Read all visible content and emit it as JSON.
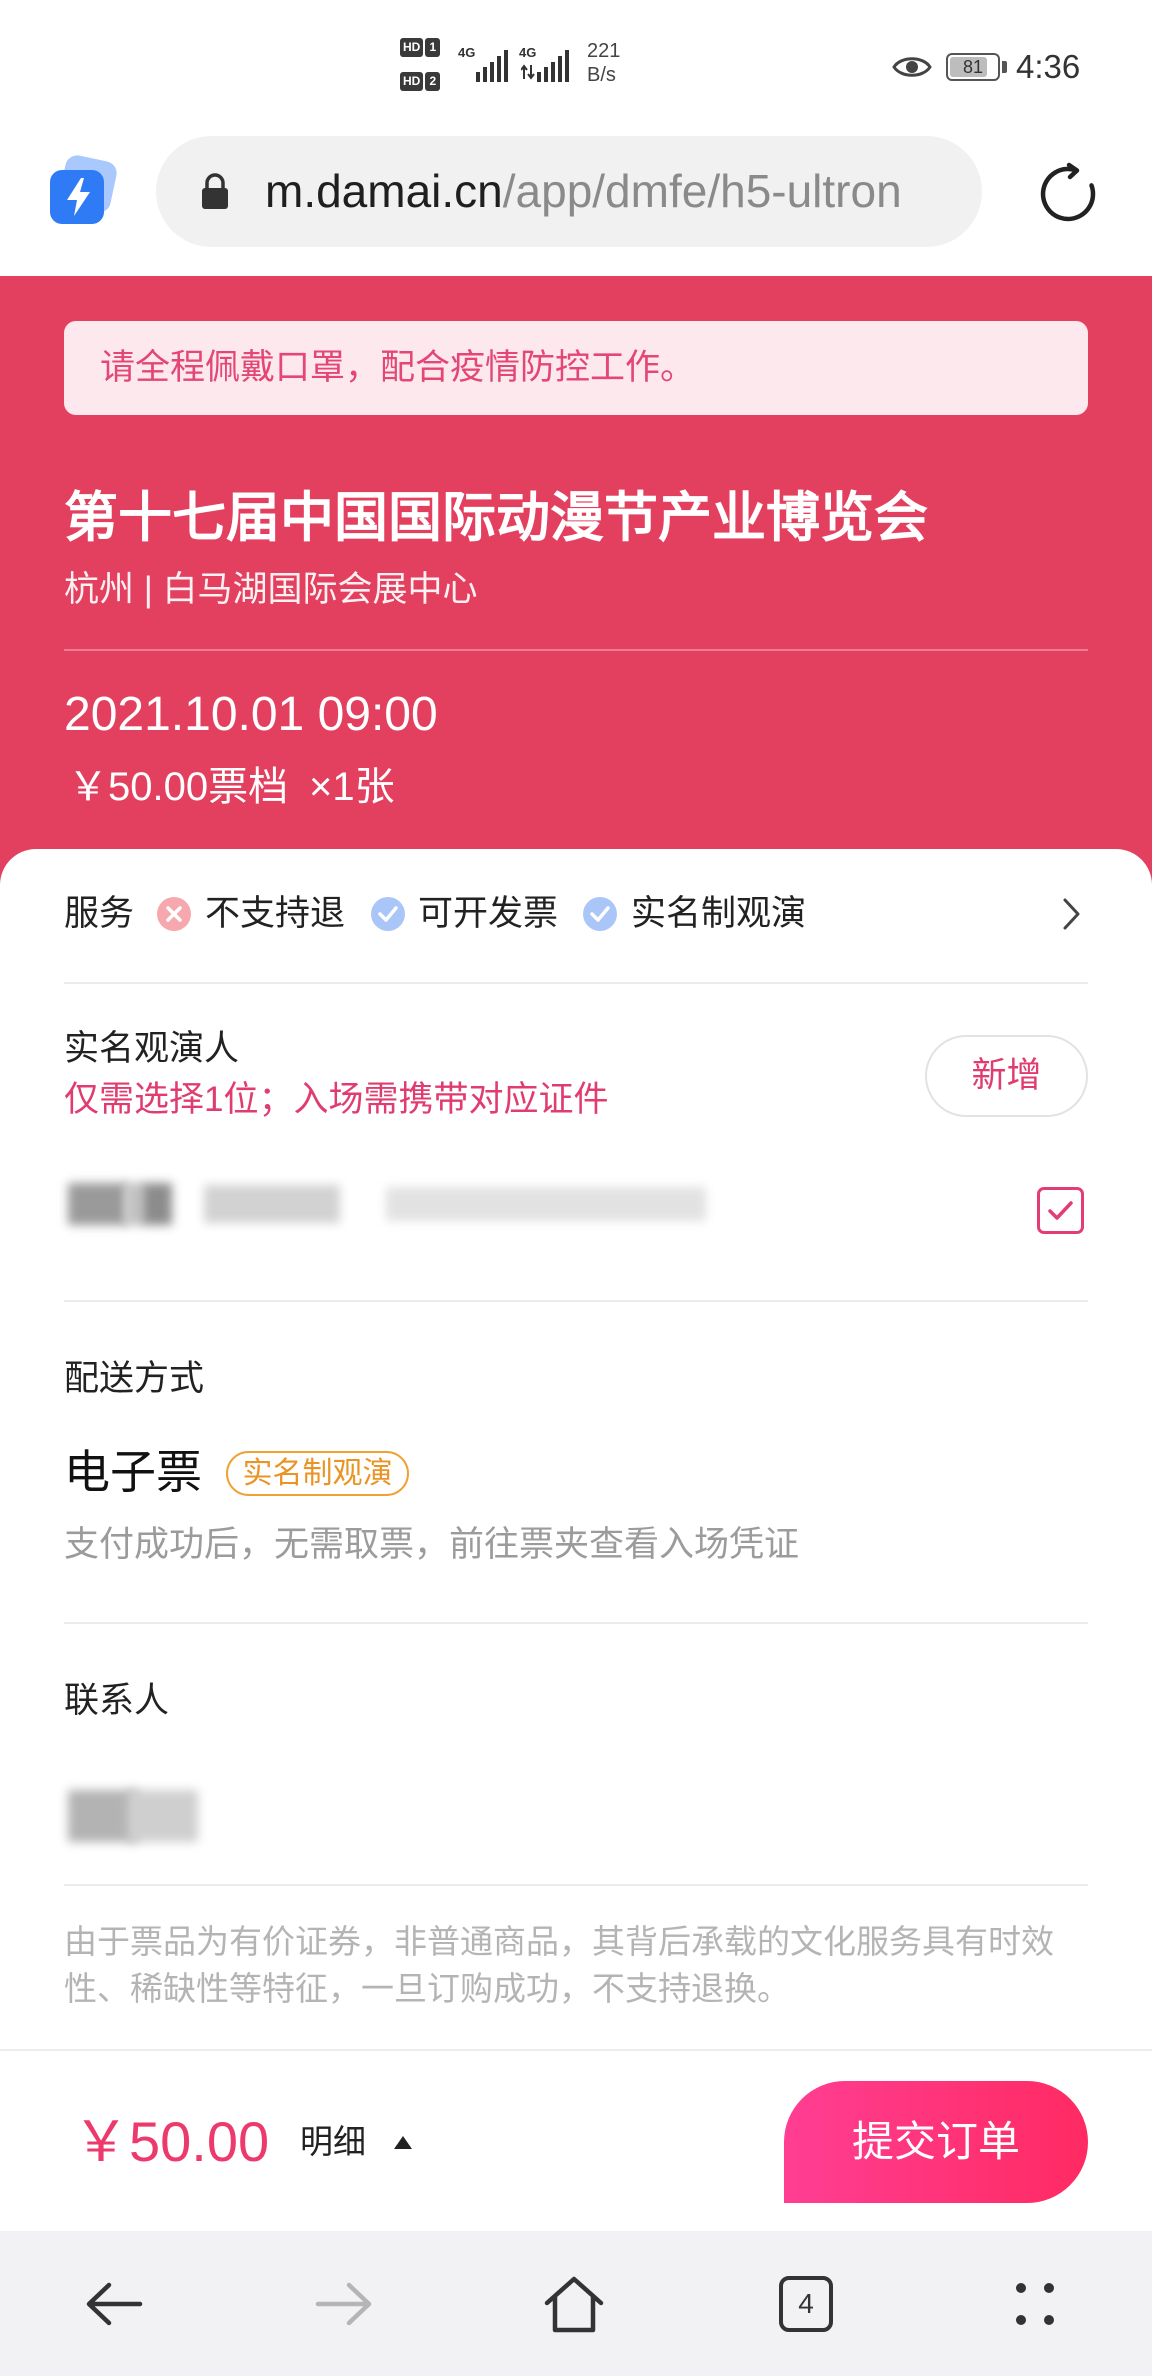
{
  "status_bar": {
    "hd_label": "HD",
    "sim_slots": [
      "1",
      "2"
    ],
    "network_types": [
      "4G",
      "4G"
    ],
    "net_speed": "221",
    "net_speed_unit": "B/s",
    "battery_level": "81",
    "time": "4:36",
    "icons": {
      "signal": "signal-bars-icon",
      "privacy": "eye-icon",
      "battery": "battery-icon"
    }
  },
  "browser": {
    "url_host": "m.damai.cn",
    "url_path": "/app/dmfe/h5-ultron",
    "icons": {
      "app": "lightning-app-icon",
      "secure": "lock-icon",
      "reload": "reload-icon"
    }
  },
  "notice": "请全程佩戴口罩，配合疫情防控工作。",
  "event": {
    "title": "第十七届中国国际动漫节产业博览会",
    "venue": "杭州 | 白马湖国际会展中心",
    "datetime": "2021.10.01 09:00",
    "ticket_tier": "￥50.00票档",
    "quantity": "×1张"
  },
  "services": {
    "label": "服务",
    "items": [
      {
        "text": "不支持退",
        "icon": "cross-circle-icon"
      },
      {
        "text": "可开发票",
        "icon": "check-circle-icon"
      },
      {
        "text": "实名制观演",
        "icon": "check-circle-icon"
      }
    ],
    "more_icon": "chevron-right-icon"
  },
  "attendee": {
    "title": "实名观演人",
    "hint": "仅需选择1位；入场需携带对应证件",
    "add_label": "新增",
    "selected": true
  },
  "delivery": {
    "title": "配送方式",
    "method": "电子票",
    "badge": "实名制观演",
    "description": "支付成功后，无需取票，前往票夹查看入场凭证"
  },
  "contact": {
    "title": "联系人"
  },
  "disclaimer": "由于票品为有价证券，非普通商品，其背后承载的文化服务具有时效性、稀缺性等特征，一旦订购成功，不支持退换。",
  "footer": {
    "total": "￥50.00",
    "detail_label": "明细",
    "detail_icon": "caret-up-icon",
    "submit_label": "提交订单"
  },
  "nav_bar": {
    "tab_count": "4",
    "icons": [
      "back-arrow-icon",
      "forward-arrow-icon",
      "home-icon",
      "tabs-icon",
      "more-dots-icon"
    ]
  },
  "colors": {
    "brand_red": "#e3405f",
    "notice_bg": "#fde8ee",
    "accent_pink": "#e33d72",
    "badge_orange": "#ec9628",
    "submit_gradient_start": "#ff3e93",
    "submit_gradient_end": "#ff2a62",
    "muted_text": "#9b9b9b"
  }
}
